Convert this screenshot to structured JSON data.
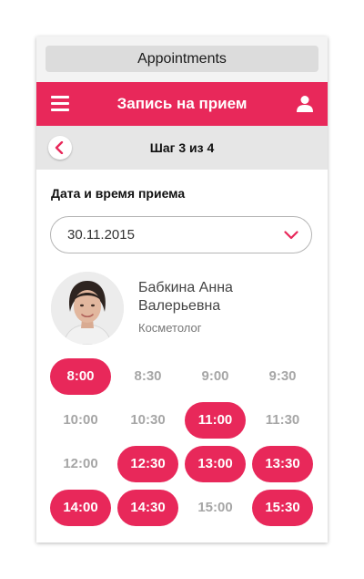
{
  "window": {
    "title": "Appointments"
  },
  "header": {
    "title": "Запись на прием",
    "menu_icon": "hamburger-menu-icon",
    "profile_icon": "user-icon"
  },
  "stepbar": {
    "step_text": "Шаг 3 из 4",
    "back_icon": "chevron-left-icon"
  },
  "form": {
    "section_label": "Дата и время приема",
    "date_value": "30.11.2015",
    "dropdown_icon": "chevron-down-icon"
  },
  "specialist": {
    "name": "Бабкина Анна Валерьевна",
    "role": "Косметолог"
  },
  "colors": {
    "accent": "#e8285a",
    "slot_unavailable_text": "#a6a6a6"
  },
  "time_slots": [
    {
      "time": "8:00",
      "available": true
    },
    {
      "time": "8:30",
      "available": false
    },
    {
      "time": "9:00",
      "available": false
    },
    {
      "time": "9:30",
      "available": false
    },
    {
      "time": "10:00",
      "available": false
    },
    {
      "time": "10:30",
      "available": false
    },
    {
      "time": "11:00",
      "available": true
    },
    {
      "time": "11:30",
      "available": false
    },
    {
      "time": "12:00",
      "available": false
    },
    {
      "time": "12:30",
      "available": true
    },
    {
      "time": "13:00",
      "available": true
    },
    {
      "time": "13:30",
      "available": true
    },
    {
      "time": "14:00",
      "available": true
    },
    {
      "time": "14:30",
      "available": true
    },
    {
      "time": "15:00",
      "available": false
    },
    {
      "time": "15:30",
      "available": true
    }
  ]
}
